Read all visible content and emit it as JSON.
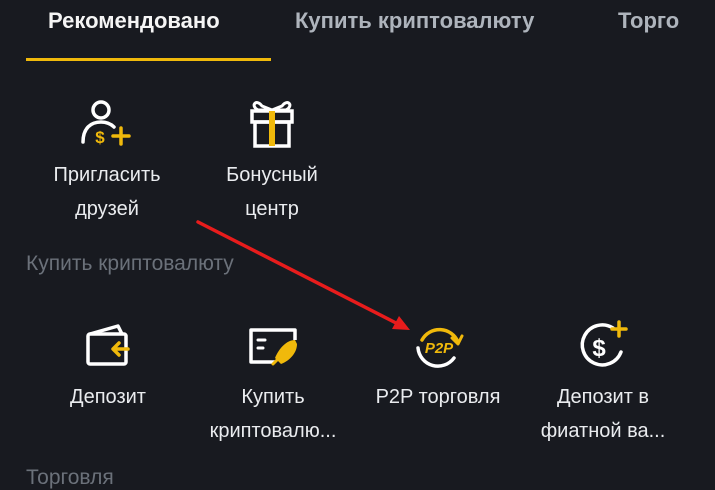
{
  "tabs": [
    {
      "label": "Рекомендовано",
      "active": true
    },
    {
      "label": "Купить криптовалюту",
      "active": false
    },
    {
      "label": "Торго",
      "active": false
    }
  ],
  "recommended": [
    {
      "label": "Пригласить\nдрузей",
      "icon": "invite-friends-icon"
    },
    {
      "label": "Бонусный\nцентр",
      "icon": "gift-icon"
    }
  ],
  "buy_section": {
    "title": "Купить криптовалюту",
    "items": [
      {
        "label": "Депозит",
        "icon": "deposit-icon"
      },
      {
        "label": "Купить\nкриптовалю...",
        "icon": "buy-crypto-icon"
      },
      {
        "label": "P2P торговля",
        "icon": "p2p-icon"
      },
      {
        "label": "Депозит в\nфиатной ва...",
        "icon": "fiat-deposit-icon"
      }
    ]
  },
  "next_section": {
    "title": "Торговля"
  },
  "colors": {
    "accent": "#f0b90b",
    "annotation_arrow": "#e81c1c"
  }
}
